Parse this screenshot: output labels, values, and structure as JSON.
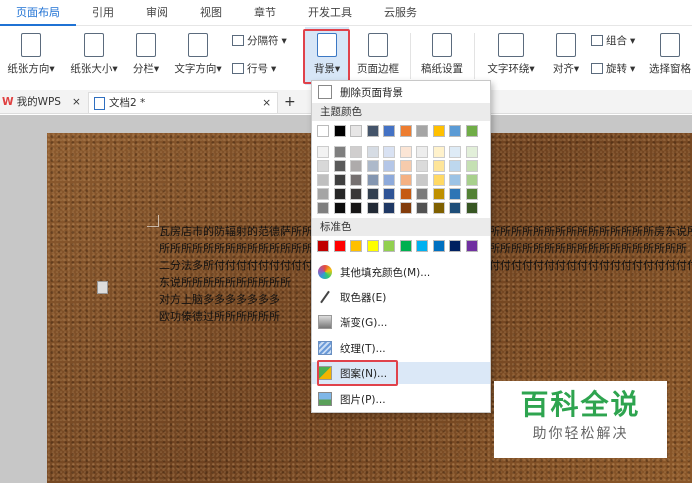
{
  "menu": {
    "tabs": [
      "页面布局",
      "引用",
      "审阅",
      "视图",
      "章节",
      "开发工具",
      "云服务"
    ],
    "active_index": 0
  },
  "ribbon": {
    "paper_direction": "纸张方向",
    "paper_size": "纸张大小",
    "columns": "分栏",
    "text_direction": "文字方向",
    "separator": "分隔符",
    "line_number": "行号",
    "background": "背景",
    "page_border": "页面边框",
    "manuscript": "稿纸设置",
    "text_wrap": "文字环绕",
    "align": "对齐",
    "group": "组合",
    "rotate": "旋转",
    "select_pane": "选择窗格",
    "dropdown_arrow": "▾"
  },
  "doc_tabs": {
    "wps_label": "我的WPS",
    "doc_label": "文档2 *",
    "close": "×",
    "add": "+"
  },
  "document": {
    "lines": [
      "瓦房店市的防辐射的范德萨所所所所所所所所所所所所所所所所所所所所所所所所所所所所所所所所所房东说所",
      "所所所所所所所所所所所所所所所所所所所所所所所所所所所所所所所所所所所所所所所所所所所所所所所所",
      "二分法多所付付付付付付付付付付付付付付付付付付付付付付付付付付付付付付付付付付付付付付付付付付付付付付付付付房",
      "东说所所所所所所所所所所",
      "对方上脑多多多多多多多",
      "欧功傣德过所所所所所所"
    ]
  },
  "dropdown": {
    "remove_bg": "删除页面背景",
    "theme_colors_title": "主题颜色",
    "standard_colors_title": "标准色",
    "more_colors": "其他填充颜色(M)...",
    "eyedropper": "取色器(E)",
    "gradient": "渐变(G)...",
    "texture": "纹理(T)...",
    "pattern": "图案(N)...",
    "picture": "图片(P)...",
    "theme_top": [
      "#ffffff",
      "#000000",
      "#e7e6e6",
      "#44546a",
      "#4472c4",
      "#ed7d31",
      "#a5a5a5",
      "#ffc000",
      "#5b9bd5",
      "#70ad47"
    ],
    "theme_shades": [
      [
        "#f2f2f2",
        "#7f7f7f",
        "#d0cece",
        "#d6dce4",
        "#d9e2f3",
        "#fbe5d5",
        "#ededed",
        "#fff2cc",
        "#deebf6",
        "#e2efd9"
      ],
      [
        "#d8d8d8",
        "#595959",
        "#aeabab",
        "#adb9ca",
        "#b4c6e7",
        "#f7cbac",
        "#dbdbdb",
        "#fee599",
        "#bdd7ee",
        "#c5e0b3"
      ],
      [
        "#bfbfbf",
        "#3f3f3f",
        "#757070",
        "#8496b0",
        "#8eaadb",
        "#f4b183",
        "#c9c9c9",
        "#ffd965",
        "#9cc3e5",
        "#a8d08d"
      ],
      [
        "#a5a5a5",
        "#262626",
        "#3a3838",
        "#323f4f",
        "#2f5496",
        "#c55a11",
        "#7b7b7b",
        "#bf9000",
        "#2e75b5",
        "#538135"
      ],
      [
        "#7f7f7f",
        "#0c0c0c",
        "#171616",
        "#222a35",
        "#1f3864",
        "#833c0b",
        "#525252",
        "#7f6000",
        "#1f4e79",
        "#375623"
      ]
    ],
    "standard": [
      "#c00000",
      "#ff0000",
      "#ffc000",
      "#ffff00",
      "#92d050",
      "#00b050",
      "#00b0f0",
      "#0070c0",
      "#002060",
      "#7030a0"
    ]
  },
  "watermark": {
    "title": "百科全说",
    "subtitle": "助你轻松解决"
  }
}
